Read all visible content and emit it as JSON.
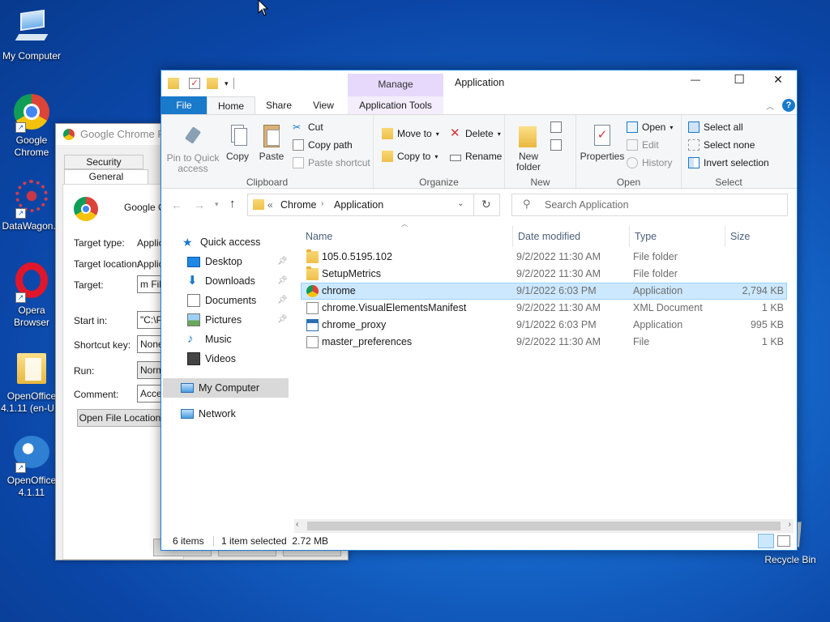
{
  "desktop": {
    "icons": [
      {
        "label": "My Computer"
      },
      {
        "label": "Google Chrome"
      },
      {
        "label": "DataWagon..."
      },
      {
        "label": "Opera Browser"
      },
      {
        "label": "OpenOffice 4.1.11 (en-U..."
      },
      {
        "label": "OpenOffice 4.1.11"
      },
      {
        "label": "Recycle Bin"
      }
    ]
  },
  "props": {
    "title": "Google Chrome Pr",
    "tabs": {
      "security": "Security",
      "general": "General"
    },
    "app_name": "Google Cl",
    "target_type_label": "Target type:",
    "target_type_value": "Applic",
    "target_location_label": "Target location:",
    "target_location_value": "Applic",
    "target_label": "Target:",
    "target_value": "m File",
    "start_in_label": "Start in:",
    "start_in_value": "\"C:\\P",
    "shortcut_key_label": "Shortcut key:",
    "shortcut_key_value": "None",
    "run_label": "Run:",
    "run_value": "Norm",
    "comment_label": "Comment:",
    "comment_value": "Acces",
    "open_location_button": "Open File Location"
  },
  "explorer": {
    "title": "Application",
    "manage_label": "Manage",
    "window_controls": {
      "minimize": "—",
      "maximize": "☐",
      "close": "✕"
    },
    "tabs": {
      "file": "File",
      "home": "Home",
      "share": "Share",
      "view": "View",
      "app_tools": "Application Tools"
    },
    "ribbon": {
      "clipboard": {
        "label": "Clipboard",
        "pin": "Pin to Quick access",
        "copy": "Copy",
        "paste": "Paste",
        "cut": "Cut",
        "copy_path": "Copy path",
        "paste_shortcut": "Paste shortcut"
      },
      "organize": {
        "label": "Organize",
        "move_to": "Move to",
        "copy_to": "Copy to",
        "delete": "Delete",
        "rename": "Rename"
      },
      "new": {
        "label": "New",
        "new_folder": "New folder"
      },
      "open": {
        "label": "Open",
        "properties": "Properties",
        "open": "Open",
        "edit": "Edit",
        "history": "History"
      },
      "select": {
        "label": "Select",
        "select_all": "Select all",
        "select_none": "Select none",
        "invert": "Invert selection"
      }
    },
    "address": {
      "prefix": "«",
      "crumbs": [
        "Chrome",
        "Application"
      ]
    },
    "search_placeholder": "Search Application",
    "nav": {
      "quick_access": "Quick access",
      "items": [
        {
          "label": "Desktop"
        },
        {
          "label": "Downloads"
        },
        {
          "label": "Documents"
        },
        {
          "label": "Pictures"
        },
        {
          "label": "Music"
        },
        {
          "label": "Videos"
        }
      ],
      "my_computer": "My Computer",
      "network": "Network"
    },
    "columns": {
      "name": "Name",
      "date": "Date modified",
      "type": "Type",
      "size": "Size"
    },
    "files": [
      {
        "name": "105.0.5195.102",
        "date": "9/2/2022 11:30 AM",
        "type": "File folder",
        "size": ""
      },
      {
        "name": "SetupMetrics",
        "date": "9/2/2022 11:30 AM",
        "type": "File folder",
        "size": ""
      },
      {
        "name": "chrome",
        "date": "9/1/2022 6:03 PM",
        "type": "Application",
        "size": "2,794 KB"
      },
      {
        "name": "chrome.VisualElementsManifest",
        "date": "9/2/2022 11:30 AM",
        "type": "XML Document",
        "size": "1 KB"
      },
      {
        "name": "chrome_proxy",
        "date": "9/1/2022 6:03 PM",
        "type": "Application",
        "size": "995 KB"
      },
      {
        "name": "master_preferences",
        "date": "9/2/2022 11:30 AM",
        "type": "File",
        "size": "1 KB"
      }
    ],
    "status": {
      "count": "6 items",
      "selection": "1 item selected  2.72 MB"
    }
  }
}
